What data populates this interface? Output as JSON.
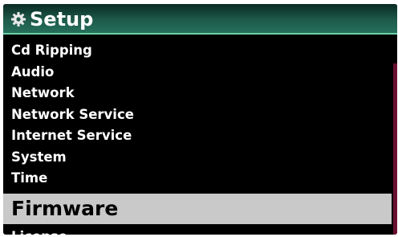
{
  "header": {
    "title": "Setup",
    "icon": "gear-icon"
  },
  "menu": {
    "items": [
      {
        "label": "Cd Ripping"
      },
      {
        "label": "Audio"
      },
      {
        "label": "Network"
      },
      {
        "label": "Network Service"
      },
      {
        "label": "Internet Service"
      },
      {
        "label": "System"
      },
      {
        "label": "Time"
      },
      {
        "label": "Firmware",
        "selected": true
      },
      {
        "label": "License"
      }
    ]
  },
  "colors": {
    "background": "#000000",
    "title_bar": "#1d5a4a",
    "title_accent": "#6fd0a8",
    "selection": "#c9c9c9",
    "scrollbar": "#6a1030"
  }
}
